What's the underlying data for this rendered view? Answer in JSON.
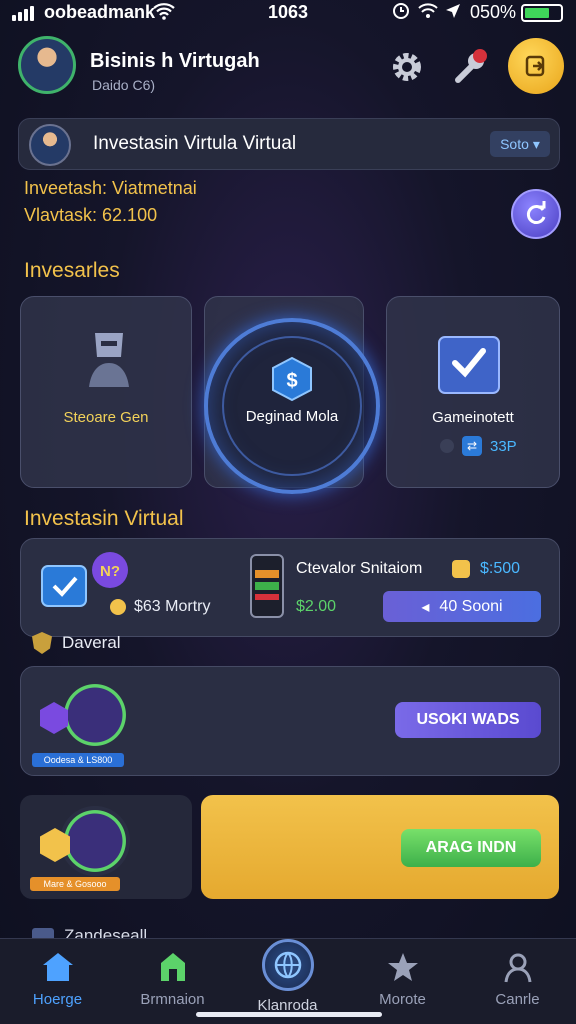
{
  "status_bar": {
    "carrier": "oobeadmank",
    "time": "1063",
    "battery_pct": "050%"
  },
  "header": {
    "user_name": "Bisinis h Virtugah",
    "user_sub": "Daido C6)"
  },
  "search": {
    "text": "Investasin Virtula Virtual",
    "dropdown": "Soto"
  },
  "info": {
    "line1": "Inveetash: Viatmetnai",
    "line2": "Vlavtask: 62.100"
  },
  "section1_title": "Invesarles",
  "tiles": {
    "left_label": "Steoare Gen",
    "mid_label": "Deginad Mola",
    "right_label": "Gameinotett",
    "right_value": "33P"
  },
  "section2_title": "Investasin Virtual",
  "portfolio": {
    "left_value": "$63 Mortry",
    "item_title": "Ctevalor Snitaiom",
    "item_price": "$:500",
    "item_value": "$2.00",
    "buy_label": "40 Sooni"
  },
  "overall_label": "Daveral",
  "card2": {
    "tag": "Oodesa & LS800",
    "button": "USOKI WADS"
  },
  "card3": {
    "tag": "Mare & Gosooo",
    "button": "ARAG INDN"
  },
  "partial_row": "Zandeseall",
  "nav": [
    {
      "label": "Hoerge"
    },
    {
      "label": "Brmnaion"
    },
    {
      "label": "Klanroda"
    },
    {
      "label": "Morote"
    },
    {
      "label": "Canrle"
    }
  ],
  "colors": {
    "accent_gold": "#f2c24b",
    "accent_blue": "#4ea2ff",
    "accent_green": "#3db04a",
    "background": "#15152a"
  }
}
